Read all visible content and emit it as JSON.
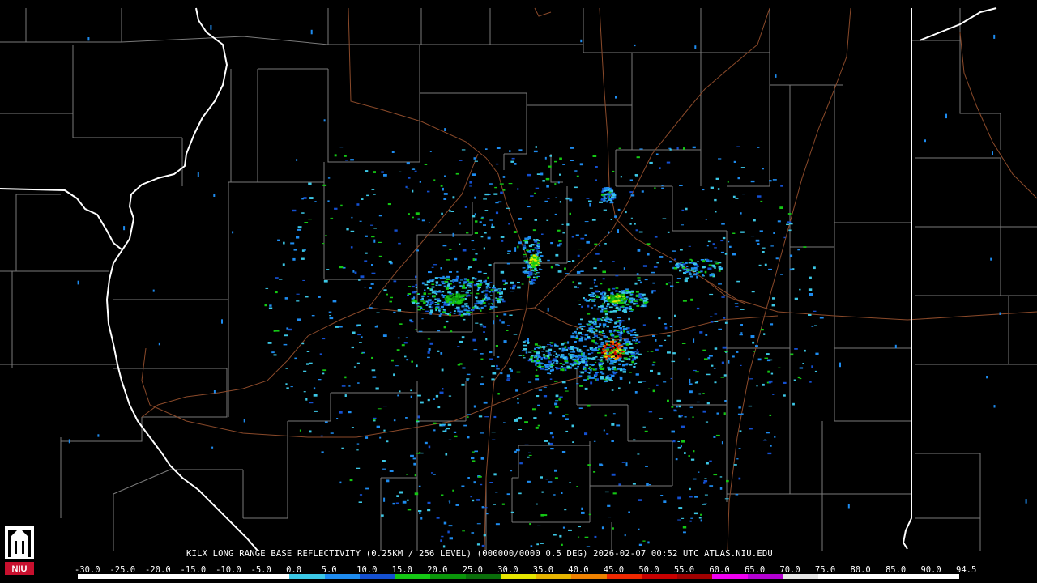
{
  "product": {
    "caption": "KILX LONG RANGE BASE REFLECTIVITY (0.25KM / 256 LEVEL) (000000/0000 0.5 DEG) 2026-02-07 00:52 UTC  ATLAS.NIU.EDU",
    "logo_text": "NIU"
  },
  "color_scale": {
    "labels": [
      "-30.0",
      "-25.0",
      "-20.0",
      "-15.0",
      "-10.0",
      "-5.0",
      "0.0",
      "5.0",
      "10.0",
      "15.0",
      "20.0",
      "25.0",
      "30.0",
      "35.0",
      "40.0",
      "45.0",
      "50.0",
      "55.0",
      "60.0",
      "65.0",
      "70.0",
      "75.0",
      "80.0",
      "85.0",
      "90.0",
      "94.5"
    ],
    "colors": [
      "#ffffff",
      "#ffffff",
      "#ffffff",
      "#ffffff",
      "#ffffff",
      "#ffffff",
      "#3cc8e6",
      "#1e8cf0",
      "#1450d2",
      "#14c814",
      "#0a960a",
      "#0a6e0a",
      "#e6e600",
      "#e6b400",
      "#f08200",
      "#f02800",
      "#c80000",
      "#a00000",
      "#f000f0",
      "#b400d2",
      "#e6e6e6",
      "#ffffff",
      "#ffffff",
      "#ffffff",
      "#ffffff"
    ]
  },
  "map": {
    "colors": {
      "background": "#000000",
      "county_lines": "#7a7a7a",
      "state_lines": "#ffffff",
      "roads": "#8b4a2a"
    }
  }
}
